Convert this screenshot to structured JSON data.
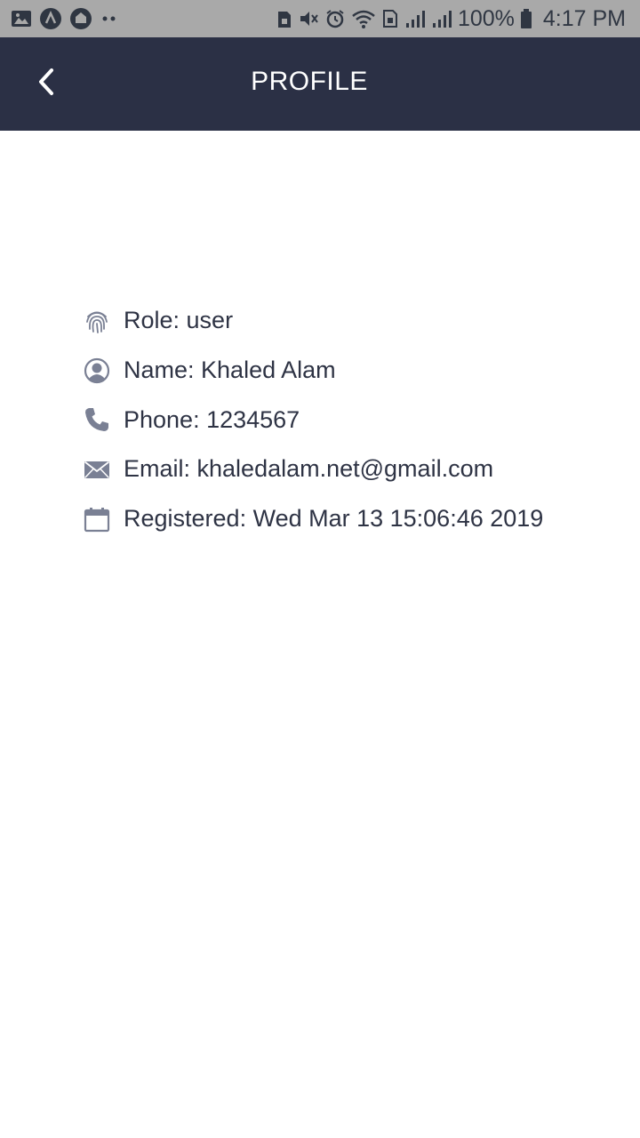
{
  "status_bar": {
    "battery_percent": "100%",
    "time": "4:17 PM",
    "icons_left": [
      "image-icon",
      "app-circle-icon",
      "app-circle-icon-2",
      "more-dots-icon"
    ],
    "icons_right": [
      "sim-lock-icon",
      "vibrate-mute-icon",
      "alarm-icon",
      "wifi-icon",
      "sim-icon",
      "signal-icon",
      "signal-icon-2",
      "battery-icon"
    ]
  },
  "header": {
    "title": "PROFILE",
    "back_icon": "chevron-left-icon",
    "background": "#2b3045"
  },
  "profile": {
    "rows": [
      {
        "icon": "fingerprint-icon",
        "text": "Role: user"
      },
      {
        "icon": "user-circle-icon",
        "text": "Name: Khaled Alam"
      },
      {
        "icon": "phone-icon",
        "text": "Phone: 1234567"
      },
      {
        "icon": "envelope-icon",
        "text": "Email: khaledalam.net@gmail.com"
      },
      {
        "icon": "calendar-icon",
        "text": "Registered: Wed Mar 13 15:06:46 2019"
      }
    ],
    "icon_color": "#7a8094",
    "text_color": "#2e3344"
  }
}
